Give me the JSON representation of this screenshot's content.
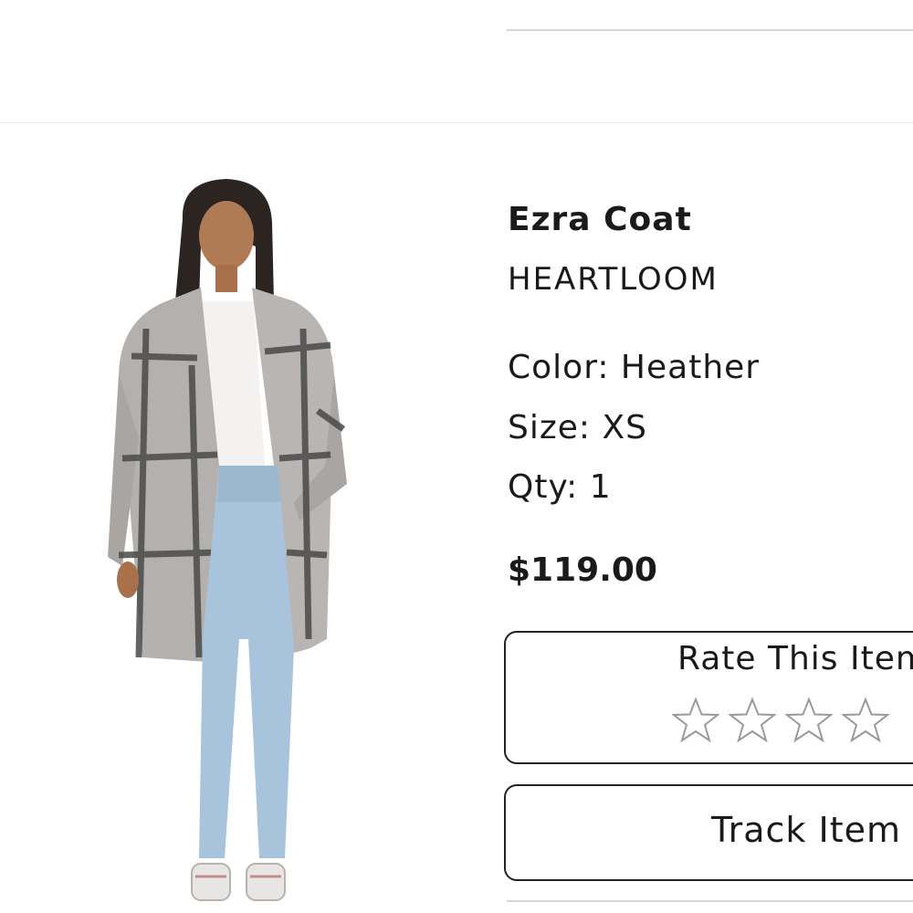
{
  "product": {
    "name": "Ezra Coat",
    "brand": "HEARTLOOM",
    "color_text": "Color: Heather",
    "size_text": "Size: XS",
    "qty_text": "Qty: 1",
    "price": "$119.00"
  },
  "rating": {
    "title": "Rate This Item",
    "value": 0,
    "star_icon": "star-outline-icon"
  },
  "actions": {
    "track_label": "Track Item"
  },
  "colors": {
    "text": "#1a1a1a",
    "divider": "#d6d6d6",
    "border": "#222222",
    "star_stroke": "#9a9a9a"
  }
}
